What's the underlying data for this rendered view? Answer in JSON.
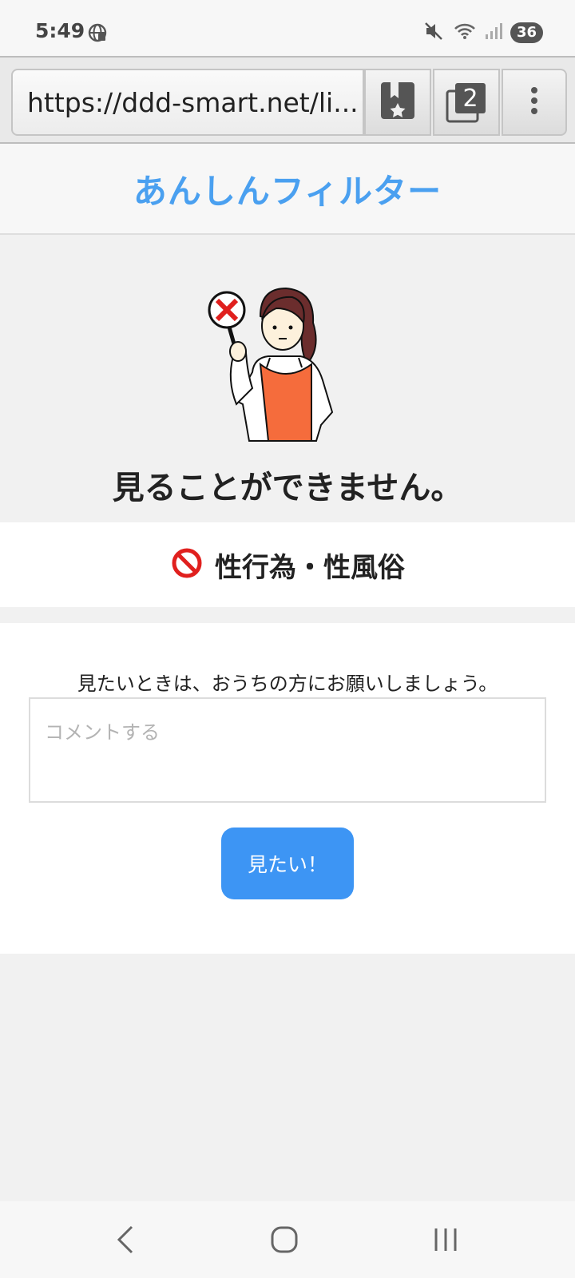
{
  "status_bar": {
    "time": "5:49",
    "battery": "36"
  },
  "browser": {
    "url": "https://ddd-smart.net/li...",
    "tab_count": "2"
  },
  "header": {
    "brand": "あんしんフィルター"
  },
  "blocked": {
    "title": "見ることができません。",
    "category": "性行為・性風俗"
  },
  "request": {
    "message": "見たいときは、おうちの方にお願いしましょう。",
    "comment_placeholder": "コメントする",
    "submit_label": "見たい！"
  },
  "colors": {
    "brand": "#4aa0f0",
    "button": "#3d95f4",
    "prohibited": "#e0201e"
  }
}
